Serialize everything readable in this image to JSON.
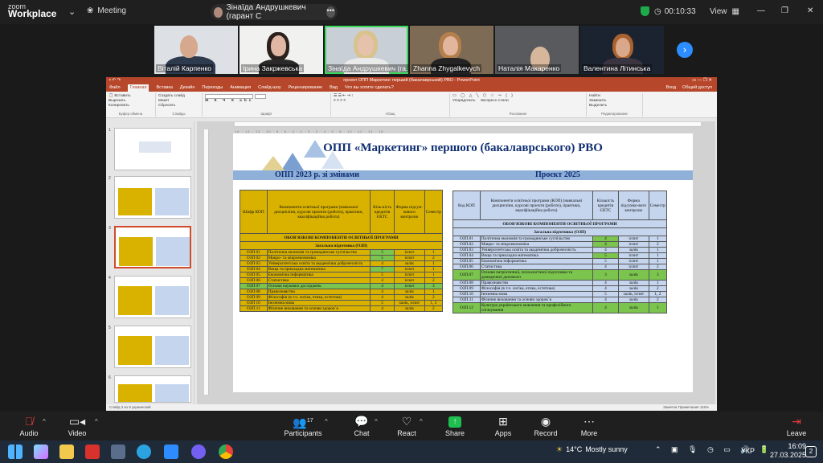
{
  "app": {
    "brand_top": "zoom",
    "brand_bottom": "Workplace",
    "meeting_label": "Meeting"
  },
  "speaker": {
    "name": "Зінаїда Андрушкевич (гарант С",
    "more": "•••"
  },
  "top_right": {
    "timer": "00:10:33",
    "view": "View"
  },
  "participants": [
    {
      "name": "Віталій Карпенко"
    },
    {
      "name": "Ірина Закржевська"
    },
    {
      "name": "Зінаїда Андрушкевич (га..."
    },
    {
      "name": "Zhanna Zhygalkevych"
    },
    {
      "name": "Наталія Макаренко"
    },
    {
      "name": "Валентина Літинська"
    }
  ],
  "ppt": {
    "title": "проект ОПП Маркетинг перший (бакалаврський) РВО - PowerPoint",
    "tabs": [
      "Файл",
      "Главная",
      "Вставка",
      "Дизайн",
      "Переходы",
      "Анимация",
      "Слайд-шоу",
      "Рецензирование",
      "Вид",
      "Что вы хотите сделать?"
    ],
    "ribbon_groups": [
      "Буфер обмена",
      "Слайды",
      "Шрифт",
      "Абзац",
      "Рисование",
      "Редактирование"
    ],
    "ribbon_items": {
      "paste": "Вставить",
      "cut": "Вырезать",
      "copy": "Копировать",
      "format": "Формат по образцу",
      "new_slide": "Создать слайд",
      "layout": "Макет",
      "reset": "Сбросить",
      "section": "Раздел",
      "find": "Найти",
      "replace": "Заменить",
      "select": "Выделить",
      "arrange": "Упорядочить",
      "styles": "Экспресс-стили"
    },
    "account": {
      "login": "Вход",
      "share": "Общий доступ"
    },
    "status": "Слайд 3 из 8   украинский",
    "status_right": "Заметки   Примечания   115%",
    "ruler_left": "16 · 14 · 12 · 10 · 8 · 6 · 4 · 2 · 0 · 2 · 4 · 6 · 8 · 10 · 12 · 14 · 16",
    "ruler_vertical": "8 6 4 2 0 2 4 6 8",
    "thumb_nums": [
      "1",
      "2",
      "3",
      "4",
      "5",
      "6"
    ]
  },
  "slide": {
    "title": "ОПП «Маркетинг» першого (бакалаврського) РВО",
    "left_head": "ОПП 2023 р. зі змінами",
    "right_head": "Проєкт 2025",
    "left_table": {
      "headers": [
        "Шифр КОП",
        "Компоненти освітньої програми (навчальні дисципліни, курсові проекти (роботи), практики, кваліфікаційна робота)",
        "Кіль-кість кредитів ЄКТС",
        "Форма підсум-кового контролю",
        "Семестр"
      ],
      "section": "ОБОВ'ЯЗКОВІ КОМПОНЕНТИ ОСВІТНЬОЇ ПРОГРАМИ",
      "subsection": "Загальна підготовка (ОЗП)",
      "rows": [
        [
          "ОЗП 01",
          "Політична економія та громадянське суспільство",
          "5",
          "іспит",
          "1"
        ],
        [
          "ОЗП 02",
          "Макро- та мікроекономіка",
          "5",
          "іспит",
          "2"
        ],
        [
          "ОЗП 03",
          "Університетська освіта та академічна доброчесність",
          "4",
          "залік",
          "1"
        ],
        [
          "ОЗП 04",
          "Вища та прикладна математика",
          "7",
          "іспит",
          "1"
        ],
        [
          "ОЗП 05",
          "Економічна інформатика",
          "5",
          "іспит",
          "1"
        ],
        [
          "ОЗП 06",
          "Статистика",
          "4",
          "іспит",
          "2"
        ],
        [
          "ОЗП 07",
          "Основи наукових досліджень",
          "4",
          "іспит",
          "3"
        ],
        [
          "ОЗП 08",
          "Правознавство",
          "4",
          "залік",
          "1"
        ],
        [
          "ОЗП 09",
          "Філософія (в т.ч. логіка, етика, естетика)",
          "4",
          "залік",
          "2"
        ],
        [
          "ОЗП 10",
          "Іноземна мова",
          "5",
          "залік, іспит",
          "1, 2"
        ],
        [
          "ОЗП 11",
          "Фізичне виховання та основи здоров`я",
          "4",
          "залік",
          "2"
        ]
      ]
    },
    "right_table": {
      "headers": [
        "Код КОП",
        "Компоненти освітньої програми (КОП) (навчальні дисципліни, курсові проєкти (роботи), практики, кваліфікаційна робота)",
        "Кількість кредитів ЄКТС",
        "Форма підсумко-вого контролю",
        "Семестр"
      ],
      "section": "ОБОВ'ЯЗКОВІ КОМПОНЕНТИ ОСВІТНЬОЇ ПРОГРАМИ",
      "subsection": "Загальна підготовка (ОЗП)",
      "rows": [
        [
          "ОЗП.01",
          "Політична економія та громадянське суспільство",
          "4",
          "іспит",
          "1"
        ],
        [
          "ОЗП.02",
          "Макро- та мікроекономіка",
          "4",
          "іспит",
          "2"
        ],
        [
          "ОЗП.03",
          "Університетська освіта та академічна доброчесність",
          "4",
          "залік",
          "1"
        ],
        [
          "ОЗП.04",
          "Вища та прикладна математика",
          "5",
          "іспит",
          "1"
        ],
        [
          "ОЗП.05",
          "Економічна інформатика",
          "5",
          "іспит",
          "1"
        ],
        [
          "ОЗП.06",
          "Статистика",
          "4",
          "іспит",
          "2"
        ],
        [
          "ОЗП.07",
          "Основи патріотичної, психологічної підготовки та домедичної допомоги",
          "3",
          "залік",
          "3"
        ],
        [
          "ОЗП.08",
          "Правознавство",
          "4",
          "залік",
          "1"
        ],
        [
          "ОЗП.09",
          "Філософія (в т.ч. логіка, етика, естетика)",
          "4",
          "залік",
          "2"
        ],
        [
          "ОЗП.10",
          "Іноземна мова",
          "5",
          "залік, іспит",
          "1, 2"
        ],
        [
          "ОЗП.11",
          "Фізичне виховання та основи здоров`я",
          "4",
          "залік",
          "2"
        ],
        [
          "ОЗП.12",
          "Культура українського мовлення та професійного спілкування",
          "4",
          "залік",
          "1"
        ]
      ]
    }
  },
  "controls": {
    "audio": "Audio",
    "video": "Video",
    "participants": "Participants",
    "participants_count": "17",
    "chat": "Chat",
    "react": "React",
    "share": "Share",
    "apps": "Apps",
    "record": "Record",
    "more": "More",
    "leave": "Leave"
  },
  "taskbar": {
    "weather": "14°C",
    "weather_text": "Mostly sunny",
    "lang": "УКР",
    "time": "16:09",
    "date": "27.03.2025",
    "notif": "2"
  },
  "colors": {
    "zoom_green": "#3cd65a",
    "zoom_blue": "#2d8cff",
    "ppt_red": "#b7472a",
    "left_table": "#d9b200",
    "right_table": "#c5d5ee",
    "highlight_green": "#7bc44e"
  }
}
